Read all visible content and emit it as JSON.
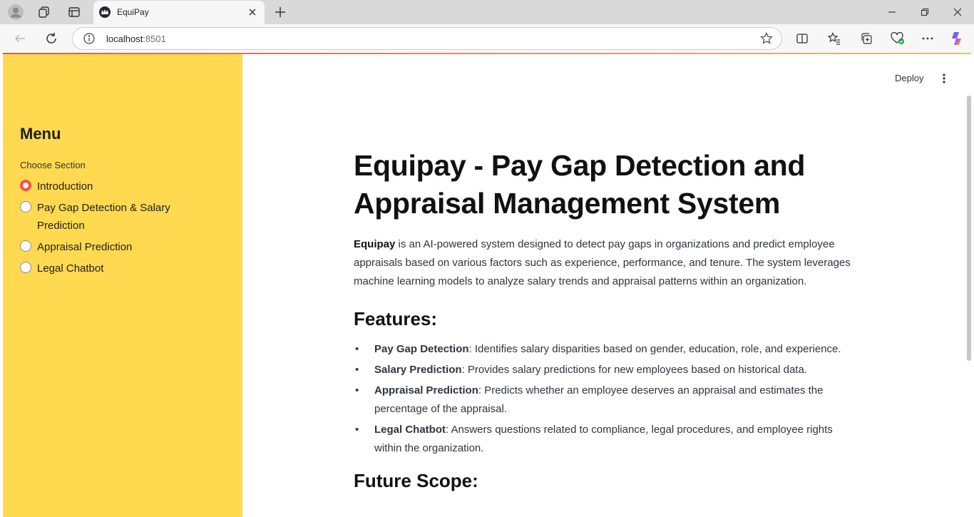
{
  "browser": {
    "tab_title": "EquiPay",
    "url_host": "localhost",
    "url_port": ":8501"
  },
  "app": {
    "deploy_label": "Deploy",
    "sidebar": {
      "title": "Menu",
      "radio_label": "Choose Section",
      "options": [
        {
          "label": "Introduction",
          "selected": true
        },
        {
          "label": "Pay Gap Detection & Salary Prediction",
          "selected": false
        },
        {
          "label": "Appraisal Prediction",
          "selected": false
        },
        {
          "label": "Legal Chatbot",
          "selected": false
        }
      ]
    },
    "main": {
      "title": "Equipay - Pay Gap Detection and Appraisal Management System",
      "intro_bold": "Equipay",
      "intro_text": " is an AI-powered system designed to detect pay gaps in organizations and predict employee appraisals based on various factors such as experience, performance, and tenure. The system leverages machine learning models to analyze salary trends and appraisal patterns within an organization.",
      "features_heading": "Features:",
      "features": [
        {
          "name": "Pay Gap Detection",
          "desc": ": Identifies salary disparities based on gender, education, role, and experience."
        },
        {
          "name": "Salary Prediction",
          "desc": ": Provides salary predictions for new employees based on historical data."
        },
        {
          "name": "Appraisal Prediction",
          "desc": ": Predicts whether an employee deserves an appraisal and estimates the percentage of the appraisal."
        },
        {
          "name": "Legal Chatbot",
          "desc": ": Answers questions related to compliance, legal procedures, and employee rights within the organization."
        }
      ],
      "future_heading": "Future Scope:"
    }
  },
  "colors": {
    "sidebar_bg": "#ffd94f",
    "accent": "#ff4b4b"
  }
}
